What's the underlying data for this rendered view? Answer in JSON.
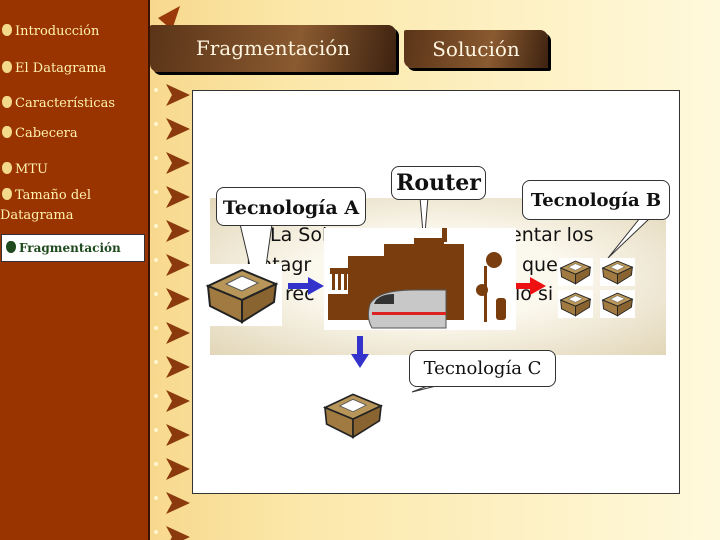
{
  "sidebar": {
    "items": [
      {
        "label": "Introducción"
      },
      {
        "label": "El Datagrama"
      },
      {
        "label": "Características"
      },
      {
        "label": "Cabecera"
      },
      {
        "label": "MTU"
      },
      {
        "label": "Tamaño del",
        "label2": "Datagrama"
      },
      {
        "label": "Fragmentación",
        "active": true
      }
    ]
  },
  "header": {
    "tabs": [
      {
        "label": "Fragmentación"
      },
      {
        "label": "Solución"
      }
    ]
  },
  "diagram": {
    "banner_fragments": [
      "La Sol",
      "entar los",
      "Datagr",
      "que",
      "rec",
      "lo si"
    ],
    "callouts": {
      "tech_a": "Tecnología A",
      "router": "Router",
      "tech_b": "Tecnología B",
      "tech_c": "Tecnología C"
    },
    "icons": [
      "package-icon",
      "router-building-icon",
      "train-icon",
      "arrow-right-icon",
      "arrow-down-icon"
    ]
  },
  "colors": {
    "sidebar": "#993300",
    "nav_text": "#fff2b0",
    "active_text": "#1e4a1e",
    "arrow_blue": "#3333cc",
    "arrow_red": "#ee1111",
    "building": "#7a3d0e"
  }
}
